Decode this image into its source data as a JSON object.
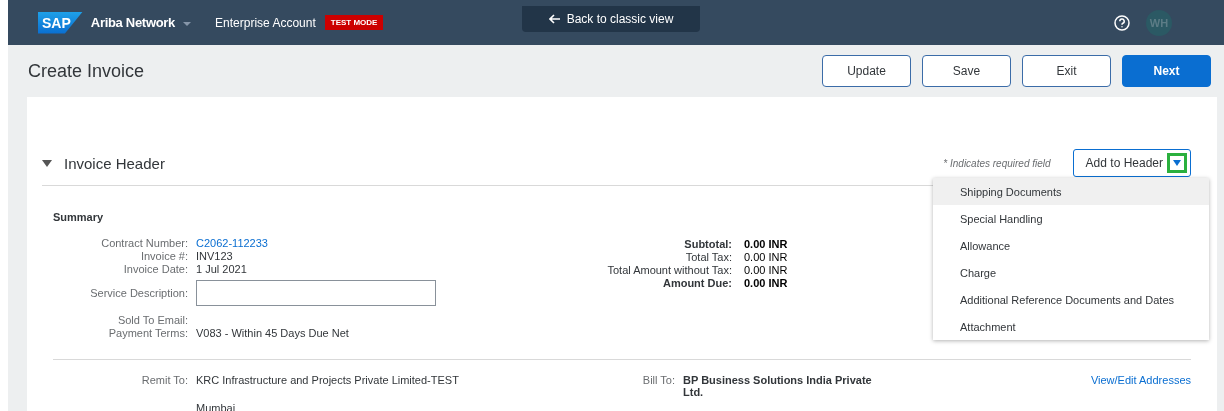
{
  "topbar": {
    "logo": "SAP",
    "product": "Ariba Network",
    "account": "Enterprise Account",
    "badge": "TEST MODE",
    "back": "Back to classic view",
    "avatar": "WH"
  },
  "page": {
    "title": "Create Invoice",
    "buttons": [
      {
        "label": "Update",
        "primary": false
      },
      {
        "label": "Save",
        "primary": false
      },
      {
        "label": "Exit",
        "primary": false
      },
      {
        "label": "Next",
        "primary": true
      }
    ]
  },
  "section": {
    "title": "Invoice Header",
    "expanded": true,
    "required_mark": "*",
    "required_note": "Indicates required field",
    "add_button": "Add to Header",
    "menu": [
      {
        "label": "Shipping Documents",
        "selected": true
      },
      {
        "label": "Special Handling",
        "selected": false
      },
      {
        "label": "Allowance",
        "selected": false
      },
      {
        "label": "Charge",
        "selected": false
      },
      {
        "label": "Additional Reference Documents and Dates",
        "selected": false
      },
      {
        "label": "Attachment",
        "selected": false
      }
    ]
  },
  "summary": {
    "title": "Summary",
    "fields": [
      {
        "label": "Contract Number:",
        "value": "C2062-112233",
        "kind": "link"
      },
      {
        "label": "Invoice #:",
        "value": "INV123",
        "kind": "text"
      },
      {
        "label": "Invoice Date:",
        "value": "1 Jul 2021",
        "kind": "text"
      },
      {
        "label": "Service Description:",
        "kind": "input"
      },
      {
        "label": "Sold To Email:",
        "kind": "text"
      },
      {
        "label": "Payment Terms:",
        "value": "V083 - Within 45 Days Due Net",
        "kind": "text"
      }
    ],
    "totals": [
      {
        "label": "Subtotal:",
        "value": "0.00 INR",
        "bold": true
      },
      {
        "label": "Total Tax:",
        "value": "0.00 INR",
        "bold": false
      },
      {
        "label": "Total Amount without Tax:",
        "value": "0.00 INR",
        "bold": false
      },
      {
        "label": "Amount Due:",
        "value": "0.00 INR",
        "bold": true
      }
    ]
  },
  "addresses": {
    "remit_label": "Remit To:",
    "remit_lines": [
      "KRC Infrastructure and Projects Private Limited-TEST",
      "Mumbai"
    ],
    "bill_label": "Bill To:",
    "bill_value": "BP Business Solutions India Private Ltd.",
    "link": "View/Edit Addresses"
  }
}
